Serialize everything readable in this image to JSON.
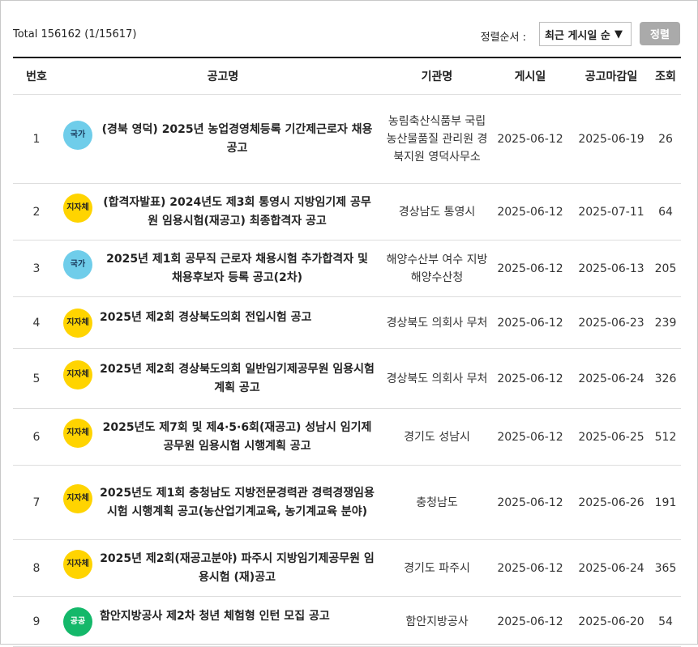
{
  "toolbar": {
    "total_text": "Total 156162 (1/15617)",
    "sort_label": "정렬순서 :",
    "sort_selected": "최근 게시일 순",
    "sort_arrow": "▼",
    "sort_button": "정렬"
  },
  "table": {
    "headers": {
      "no": "번호",
      "title": "공고명",
      "org": "기관명",
      "posted": "게시일",
      "deadline": "공고마감일",
      "views": "조회"
    },
    "badge_colors": {
      "national": "#6fcdea",
      "local": "#ffd400",
      "public": "#14b86a"
    },
    "rows": [
      {
        "no": "1",
        "badge": "국가",
        "title": "(경북 영덕) 2025년 농업경영체등록 기간제근로자 채용 공고",
        "org": "농림축산식품부 국립농산물품질 관리원 경북지원 영덕사무소",
        "posted": "2025-06-12",
        "deadline": "2025-06-19",
        "views": "26"
      },
      {
        "no": "2",
        "badge": "지자체",
        "title": "(합격자발표) 2024년도 제3회 통영시 지방임기제 공무원 임용시험(재공고) 최종합격자 공고",
        "org": "경상남도 통영시",
        "posted": "2025-06-12",
        "deadline": "2025-07-11",
        "views": "64"
      },
      {
        "no": "3",
        "badge": "국가",
        "title": "2025년 제1회 공무직 근로자 채용시험 추가합격자 및 채용후보자 등록 공고(2차)",
        "org": "해양수산부 여수 지방해양수산청",
        "posted": "2025-06-12",
        "deadline": "2025-06-13",
        "views": "205"
      },
      {
        "no": "4",
        "badge": "지자체",
        "title": "2025년 제2회 경상북도의회 전입시험 공고",
        "org": "경상북도 의회사 무처",
        "posted": "2025-06-12",
        "deadline": "2025-06-23",
        "views": "239"
      },
      {
        "no": "5",
        "badge": "지자체",
        "title": "2025년 제2회 경상북도의회 일반임기제공무원 임용시험 계획 공고",
        "org": "경상북도 의회사 무처",
        "posted": "2025-06-12",
        "deadline": "2025-06-24",
        "views": "326"
      },
      {
        "no": "6",
        "badge": "지자체",
        "title": "2025년도 제7회 및 제4·5·6회(재공고) 성남시 임기제공무원 임용시험 시행계획 공고",
        "org": "경기도 성남시",
        "posted": "2025-06-12",
        "deadline": "2025-06-25",
        "views": "512"
      },
      {
        "no": "7",
        "badge": "지자체",
        "title": "2025년도 제1회 충청남도 지방전문경력관 경력경쟁임용시험 시행계획 공고(농산업기계교육, 농기계교육 분야)",
        "org": "충청남도",
        "posted": "2025-06-12",
        "deadline": "2025-06-26",
        "views": "191"
      },
      {
        "no": "8",
        "badge": "지자체",
        "title": "2025년 제2회(재공고분야) 파주시 지방임기제공무원 임용시험 (재)공고",
        "org": "경기도 파주시",
        "posted": "2025-06-12",
        "deadline": "2025-06-24",
        "views": "365"
      },
      {
        "no": "9",
        "badge": "공공",
        "title": "함안지방공사 제2차 청년 체험형 인턴 모집 공고",
        "org": "함안지방공사",
        "posted": "2025-06-12",
        "deadline": "2025-06-20",
        "views": "54"
      }
    ]
  }
}
